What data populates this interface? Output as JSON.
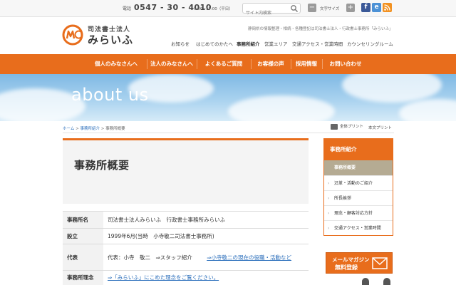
{
  "topbar": {
    "tel_label": "電話",
    "tel_number": "0547 - 30 - 4010",
    "hours": "9:00~17:00（平日）",
    "search_placeholder": "サイト内検索",
    "font_size_label": "文字サイズ",
    "font_minus": "−",
    "font_plus": "+",
    "social": [
      "f",
      "e",
      "rss"
    ]
  },
  "header": {
    "logo_small": "司法書士法人",
    "logo_main": "みらいふ",
    "tagline": "静岡県の情報整理・相続・各種登記は司法書士法人・行政書士事務所「みらいふ」",
    "subnav": [
      "お知らせ",
      "はじめてのかたへ",
      "事務所紹介",
      "営業エリア",
      "交通アクセス・営業時間",
      "カウンセリングルーム"
    ],
    "subnav_active_index": 2
  },
  "mainnav": [
    "個人のみなさんへ",
    "法人のみなさんへ",
    "よくあるご質問",
    "お客様の声",
    "採用情報",
    "お問い合わせ"
  ],
  "hero": {
    "title": "about us"
  },
  "breadcrumb": {
    "home": "ホーム",
    "parent": "事務所紹介",
    "sep": ">",
    "current": "事務所概要"
  },
  "print": {
    "all": "全体プリント",
    "body": "本文プリント"
  },
  "page": {
    "title": "事務所概要"
  },
  "info_table": {
    "rows": [
      {
        "label": "事務所名",
        "value": "司法書士法人みらいふ　行政書士事務所みらいふ"
      },
      {
        "label": "設立",
        "value": "1999年6月(当時　小寺敬二司法書士事務所)"
      },
      {
        "label": "代表",
        "value": "代表：小寺　敬二　⇒スタッフ紹介",
        "link": "⇒小寺敬二の現在の役職・活動など"
      },
      {
        "label": "事務所理念",
        "link": "⇒「みらいふ」にこめた理念をご覧ください。"
      }
    ]
  },
  "sidebar": {
    "heading": "事務所紹介",
    "items": [
      "事務所概要",
      "沿革・活動のご紹介",
      "所長挨拶",
      "理念・顧客対応方針",
      "交通アクセス・営業時間"
    ],
    "current_index": 0
  },
  "mail_banner": {
    "line1": "メールマガジン",
    "line2": "無料登録"
  },
  "colors": {
    "accent": "#e86d1c",
    "link": "#2a6ebb",
    "sidebar_current": "#b5ab93"
  }
}
